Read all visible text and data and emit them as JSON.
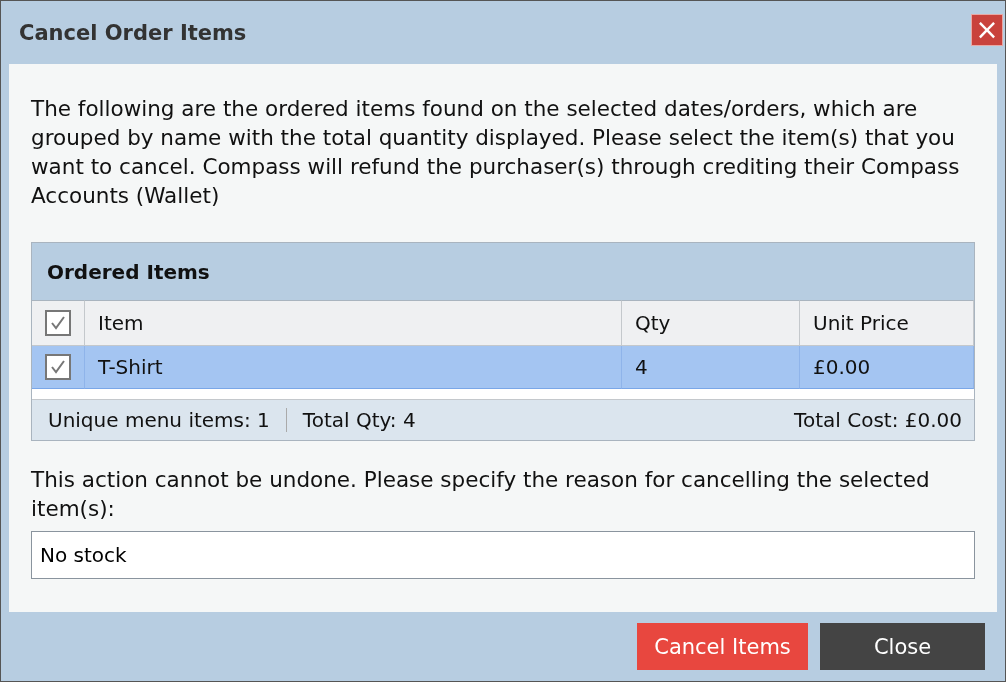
{
  "dialog": {
    "title": "Cancel Order Items",
    "close_icon": "×"
  },
  "intro": "The following are the ordered items found on the selected dates/orders, which are grouped by name with the total quantity displayed. Please select the item(s) that you want to cancel. Compass will refund the purchaser(s) through crediting their Compass Accounts (Wallet)",
  "grid": {
    "title": "Ordered Items",
    "select_all_checked": true,
    "columns": [
      "Item",
      "Qty",
      "Unit Price"
    ],
    "rows": [
      {
        "item": "T-Shirt",
        "qty": "4",
        "unit_price": "£0.00",
        "checked": true,
        "selected": true
      }
    ],
    "summary": {
      "unique": "Unique menu items: 1",
      "total_qty": "Total Qty: 4",
      "total_cost": "Total Cost: £0.00"
    }
  },
  "reason_prompt": "This action cannot be undone. Please specify the reason for cancelling the selected item(s):",
  "reason": {
    "value": "No stock"
  },
  "buttons": [
    {
      "label": "Cancel Items",
      "kind": "danger"
    },
    {
      "label": "Close",
      "kind": "dark"
    }
  ]
}
